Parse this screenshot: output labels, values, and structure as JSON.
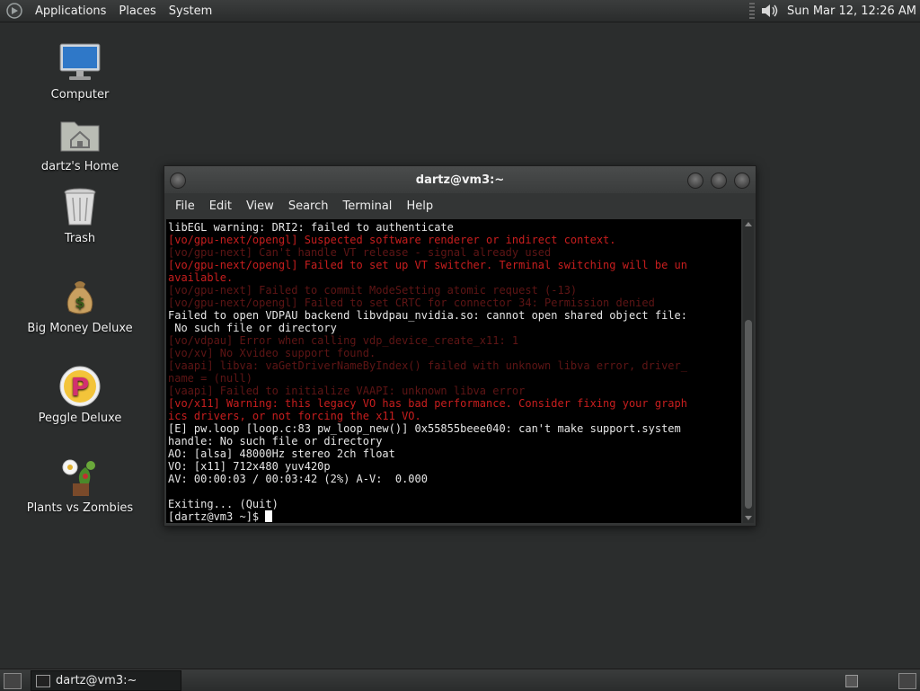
{
  "top_panel": {
    "menus": [
      "Applications",
      "Places",
      "System"
    ],
    "clock": "Sun Mar 12, 12:26 AM"
  },
  "desktop": {
    "icons": [
      {
        "label": "Computer",
        "icon": "computer-icon"
      },
      {
        "label": "dartz's Home",
        "icon": "home-folder-icon"
      },
      {
        "label": "Trash",
        "icon": "trash-icon"
      },
      {
        "label": "Big Money Deluxe",
        "icon": "money-bag-icon"
      },
      {
        "label": "Peggle Deluxe",
        "icon": "peggle-icon"
      },
      {
        "label": "Plants vs Zombies",
        "icon": "plants-icon"
      }
    ]
  },
  "window": {
    "title": "dartz@vm3:~",
    "menu": [
      "File",
      "Edit",
      "View",
      "Search",
      "Terminal",
      "Help"
    ],
    "lines": [
      {
        "text": "libEGL warning: DRI2: failed to authenticate",
        "style": "white"
      },
      {
        "text": "[vo/gpu-next/opengl] Suspected software renderer or indirect context.",
        "style": "red"
      },
      {
        "text": "[vo/gpu-next] Can't handle VT release - signal already used",
        "style": "dim"
      },
      {
        "text": "[vo/gpu-next/opengl] Failed to set up VT switcher. Terminal switching will be un",
        "style": "red"
      },
      {
        "text": "available.",
        "style": "red"
      },
      {
        "text": "[vo/gpu-next] Failed to commit ModeSetting atomic request (-13)",
        "style": "dim"
      },
      {
        "text": "[vo/gpu-next/opengl] Failed to set CRTC for connector 34: Permission denied",
        "style": "dim"
      },
      {
        "text": "Failed to open VDPAU backend libvdpau_nvidia.so: cannot open shared object file:",
        "style": "white"
      },
      {
        "text": " No such file or directory",
        "style": "white"
      },
      {
        "text": "[vo/vdpau] Error when calling vdp_device_create_x11: 1",
        "style": "dim"
      },
      {
        "text": "[vo/xv] No Xvideo support found.",
        "style": "dim"
      },
      {
        "text": "[vaapi] libva: vaGetDriverNameByIndex() failed with unknown libva error, driver_",
        "style": "dim"
      },
      {
        "text": "name = (null)",
        "style": "dim"
      },
      {
        "text": "[vaapi] Failed to initialize VAAPI: unknown libva error",
        "style": "dim"
      },
      {
        "text": "[vo/x11] Warning: this legacy VO has bad performance. Consider fixing your graph",
        "style": "red"
      },
      {
        "text": "ics drivers, or not forcing the x11 VO.",
        "style": "red"
      },
      {
        "text": "[E] pw.loop [loop.c:83 pw_loop_new()] 0x55855beee040: can't make support.system",
        "style": "white"
      },
      {
        "text": "handle: No such file or directory",
        "style": "white"
      },
      {
        "text": "AO: [alsa] 48000Hz stereo 2ch float",
        "style": "white"
      },
      {
        "text": "VO: [x11] 712x480 yuv420p",
        "style": "white"
      },
      {
        "text": "AV: 00:00:03 / 00:03:42 (2%) A-V:  0.000",
        "style": "white"
      },
      {
        "text": "",
        "style": "white"
      },
      {
        "text": "Exiting... (Quit)",
        "style": "white"
      }
    ],
    "prompt": "[dartz@vm3 ~]$ "
  },
  "bottom_panel": {
    "task_label": "dartz@vm3:~"
  }
}
